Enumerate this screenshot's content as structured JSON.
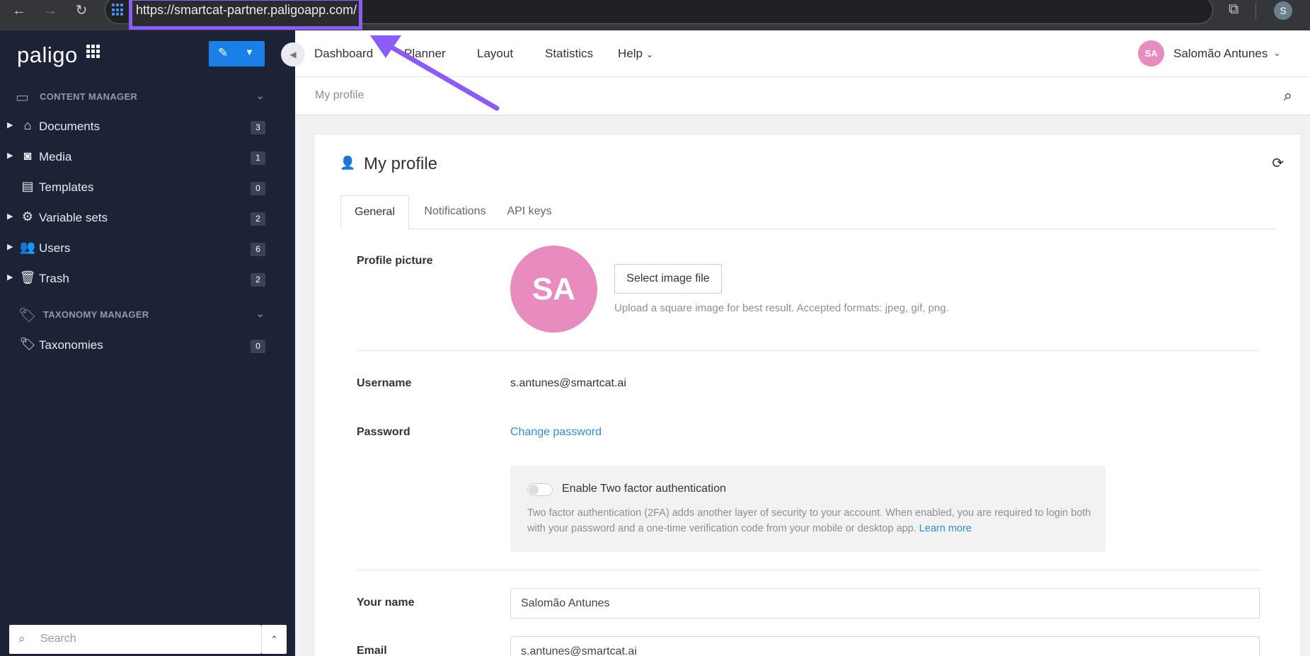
{
  "browser": {
    "url": "https://smartcat-partner.paligoapp.com/",
    "profile_initial": "S"
  },
  "sidebar": {
    "logo": "paligo",
    "content_manager_label": "CONTENT MANAGER",
    "taxonomy_manager_label": "TAXONOMY MANAGER",
    "items": [
      {
        "label": "Documents",
        "count": "3",
        "icon": "home-icon",
        "expandable": true
      },
      {
        "label": "Media",
        "count": "1",
        "icon": "camera-icon",
        "expandable": true
      },
      {
        "label": "Templates",
        "count": "0",
        "icon": "book-icon",
        "expandable": false
      },
      {
        "label": "Variable sets",
        "count": "2",
        "icon": "gears-icon",
        "expandable": true
      },
      {
        "label": "Users",
        "count": "6",
        "icon": "users-icon",
        "expandable": true
      },
      {
        "label": "Trash",
        "count": "2",
        "icon": "trash-icon",
        "expandable": true
      }
    ],
    "taxonomy_items": [
      {
        "label": "Taxonomies",
        "count": "0",
        "icon": "tags-icon"
      }
    ],
    "search_placeholder": "Search"
  },
  "topnav": {
    "items": [
      "Dashboard",
      "Planner",
      "Layout",
      "Statistics",
      "Help"
    ],
    "user_initials": "SA",
    "user_name": "Salomão Antunes"
  },
  "breadcrumb": "My profile",
  "profile": {
    "title": "My profile",
    "tabs": [
      "General",
      "Notifications",
      "API keys"
    ],
    "active_tab": "General",
    "profile_picture_label": "Profile picture",
    "avatar_initials": "SA",
    "select_image_label": "Select image file",
    "upload_hint": "Upload a square image for best result. Accepted formats: jpeg, gif, png.",
    "username_label": "Username",
    "username_value": "s.antunes@smartcat.ai",
    "password_label": "Password",
    "change_password_label": "Change password",
    "tfa_title": "Enable Two factor authentication",
    "tfa_desc": "Two factor authentication (2FA) adds another layer of security to your account. When enabled, you are required to login both with your password and a one-time verification code from your mobile or desktop app.",
    "tfa_learn_more": "Learn more",
    "tfa_enabled": false,
    "your_name_label": "Your name",
    "your_name_value": "Salomão Antunes",
    "email_label": "Email",
    "email_value": "s.antunes@smartcat.ai"
  },
  "colors": {
    "sidebar_bg": "#1d2336",
    "accent": "#1a7fe6",
    "avatar": "#e88bbf",
    "annotation": "#8b5cf6",
    "link": "#2d8fd6"
  }
}
